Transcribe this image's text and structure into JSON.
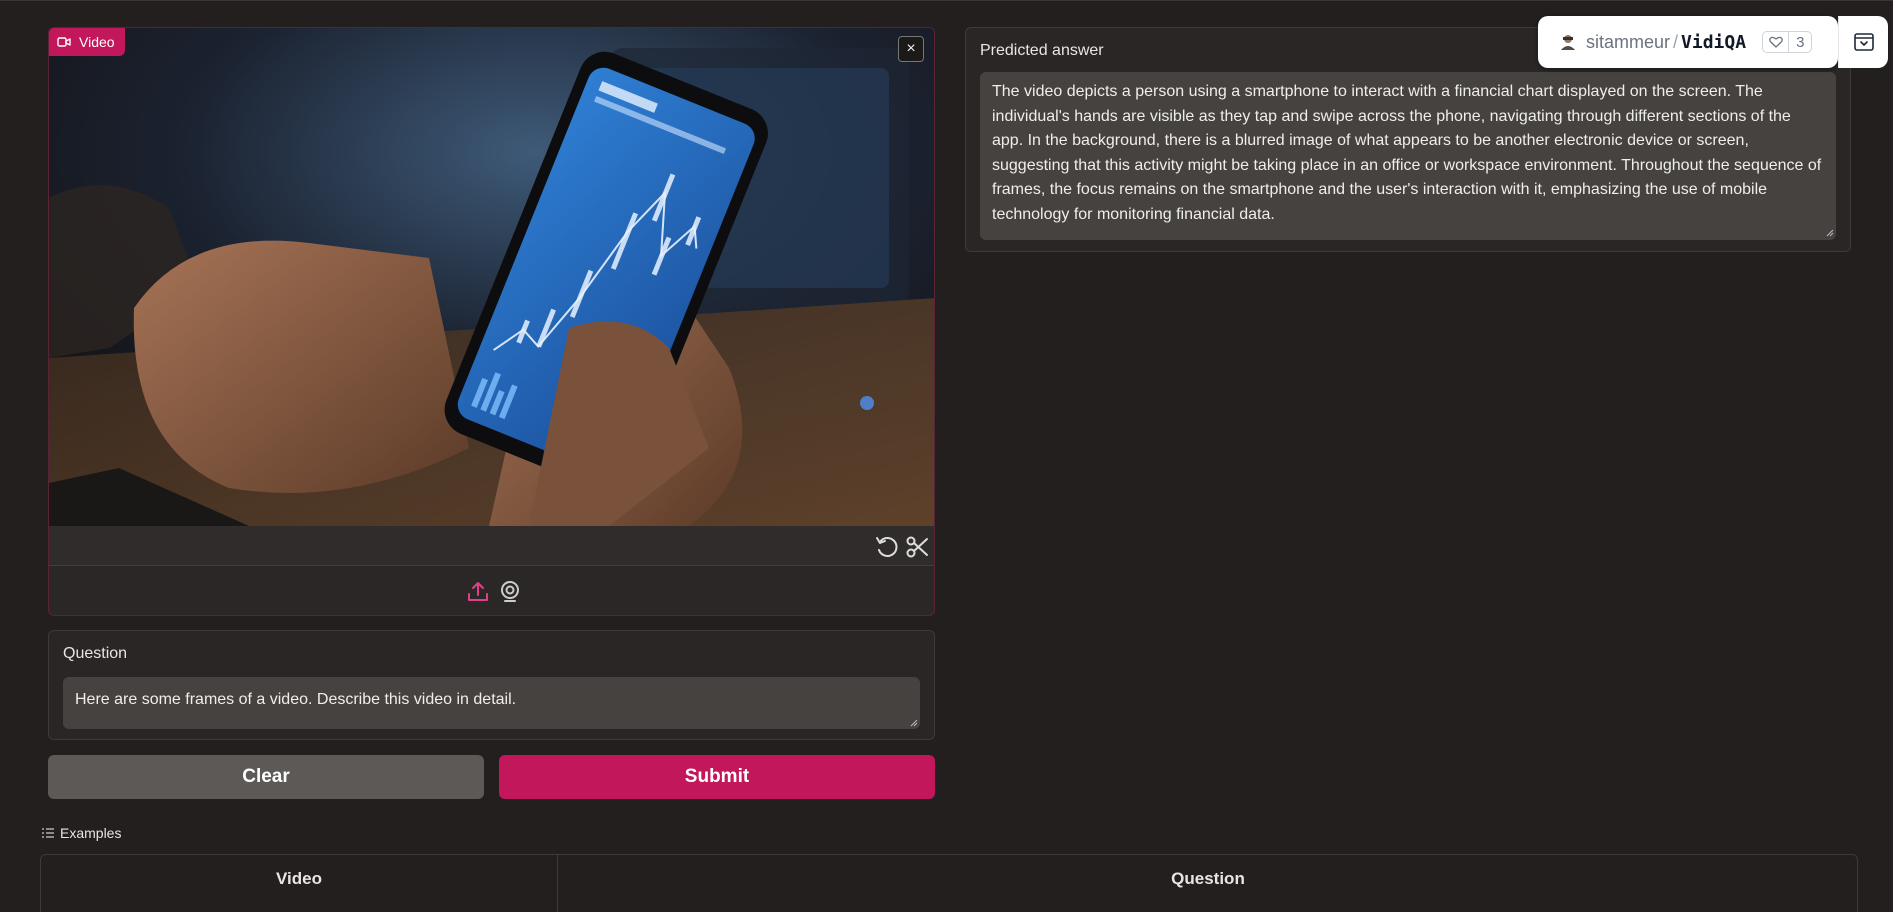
{
  "video": {
    "badge_label": "Video",
    "close_label": "×",
    "icons": [
      "video-icon",
      "close-icon",
      "undo-icon",
      "scissors-icon",
      "upload-icon",
      "webcam-icon"
    ]
  },
  "question": {
    "label": "Question",
    "value": "Here are some frames of a video. Describe this video in detail."
  },
  "buttons": {
    "clear_label": "Clear",
    "submit_label": "Submit"
  },
  "examples": {
    "title": "Examples",
    "columns": [
      "Video",
      "Question"
    ]
  },
  "answer": {
    "label": "Predicted answer",
    "text": "The video depicts a person using a smartphone to interact with a financial chart displayed on the screen. The individual's hands are visible as they tap and swipe across the phone, navigating through different sections of the app. In the background, there is a blurred image of what appears to be another electronic device or screen, suggesting that this activity might be taking place in an office or workspace environment. Throughout the sequence of frames, the focus remains on the smartphone and the user's interaction with it, emphasizing the use of mobile technology for monitoring financial data."
  },
  "header": {
    "owner": "sitammeur",
    "separator": "/",
    "repo": "VidiQA",
    "likes": "3"
  },
  "colors": {
    "accent": "#c2185b",
    "background": "#221f1e",
    "panel": "#292625",
    "input": "#45423f",
    "clear_button": "#5c5956"
  }
}
